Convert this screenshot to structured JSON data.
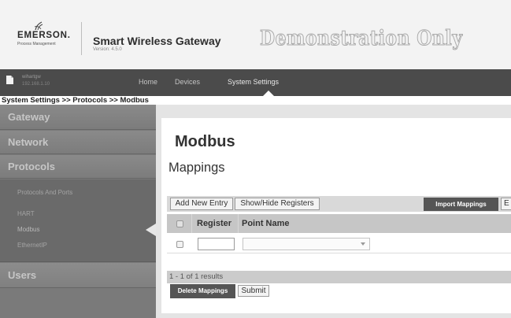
{
  "header": {
    "logo": {
      "brand": "EMERSON.",
      "tagline": "Process Management",
      "icon": "emerson-mark-icon"
    },
    "app_title": "Smart Wireless Gateway",
    "version": "Version: 4.5.0",
    "watermark": "Demonstration Only"
  },
  "topnav": {
    "device_icon": "gateway-icon",
    "host_name": "wihartgw",
    "host_ip": "192.168.1.10",
    "items": [
      {
        "label": "Home",
        "active": false
      },
      {
        "label": "Devices",
        "active": false
      },
      {
        "label": "System Settings",
        "active": true
      }
    ]
  },
  "breadcrumb": "System Settings >> Protocols >> Modbus",
  "sidebar": {
    "sections": [
      {
        "label": "Gateway"
      },
      {
        "label": "Network"
      },
      {
        "label": "Protocols",
        "expanded": true,
        "children": [
          {
            "label": "Protocols And Ports",
            "active": false
          },
          {
            "label": "HART",
            "active": false
          },
          {
            "label": "Modbus",
            "active": true
          },
          {
            "label": "EthernetIP",
            "active": false
          }
        ]
      },
      {
        "label": "Users"
      }
    ]
  },
  "main": {
    "page_title": "Modbus",
    "section_title": "Mappings",
    "toolbar": {
      "add_entry_label": "Add New Entry",
      "show_hide_registers_label": "Show/Hide Registers",
      "import_label": "Import Mappings",
      "export_label": "E"
    },
    "table": {
      "columns": [
        {
          "label": "Register"
        },
        {
          "label": "Point Name"
        }
      ],
      "rows": [
        {
          "selected": false,
          "register": "",
          "point_name": ""
        }
      ]
    },
    "results_summary": "1 - 1 of 1 results",
    "actions": {
      "delete_label": "Delete Mappings",
      "submit_label": "Submit"
    },
    "icons": {
      "dropdown": "chevron-down-icon"
    }
  },
  "colors": {
    "header_bg": "#f3f3f3",
    "nav_bg": "#4b4b4b",
    "sidebar_bg": "#7a7a7a",
    "content_bg": "#e4e4e4",
    "dark_button": "#555555"
  }
}
